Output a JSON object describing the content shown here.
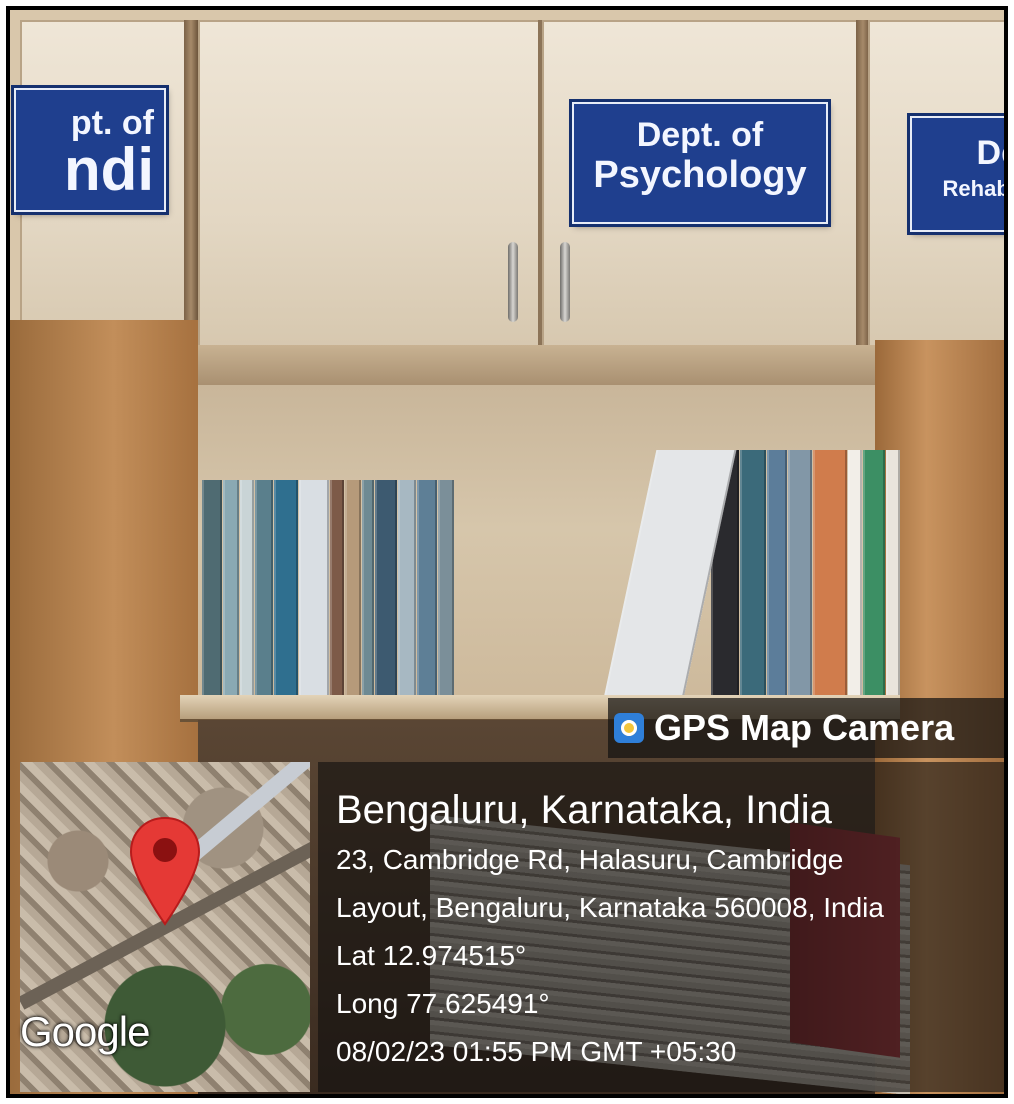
{
  "signs": {
    "left": {
      "line1": "pt. of",
      "line2": "ndi"
    },
    "middle": {
      "line1": "Dept. of",
      "line2": "Psychology"
    },
    "right": {
      "line1": "De",
      "line2": "Rehabil"
    }
  },
  "overlay": {
    "app_name": "GPS Map Camera",
    "map_brand": "Google",
    "location_title": "Bengaluru, Karnataka, India",
    "address_line1": "23, Cambridge Rd, Halasuru, Cambridge",
    "address_line2": "Layout, Bengaluru, Karnataka 560008, India",
    "latitude": "Lat 12.974515°",
    "longitude": "Long 77.625491°",
    "timestamp": "08/02/23 01:55 PM GMT +05:30"
  },
  "colors": {
    "sign_blue": "#1f3f8e",
    "pin_red": "#e53935",
    "overlay_dark": "#121010"
  }
}
